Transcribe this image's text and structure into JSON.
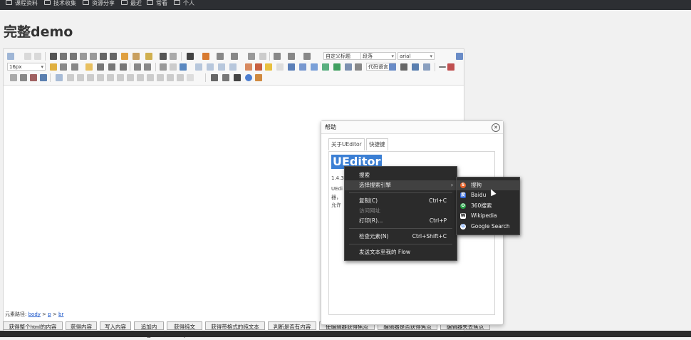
{
  "bookmarks": [
    "课程资料",
    "技术收集",
    "资源分享",
    "最近",
    "常看",
    "个人"
  ],
  "page_title": "完整demo",
  "toolbar": {
    "font_size": "16px",
    "custom_title": "自定义标题",
    "paragraph": "段落",
    "font_family": "arial",
    "code_lang": "代码语言"
  },
  "element_path": {
    "label": "元素路径:",
    "body": "body",
    "p": "p",
    "br": "br",
    "sep": ">"
  },
  "buttons": [
    "获得整个html的内容",
    "获得内容",
    "写入内容",
    "追加内容",
    "获得纯文本",
    "获得带格式的纯文本",
    "判断是否有内容",
    "使编辑器获得焦点",
    "编辑器是否获得焦点",
    "编辑器失去焦点"
  ],
  "dialog": {
    "title": "帮助",
    "close": "✕",
    "tabs": [
      "关于UEditor",
      "快捷键"
    ],
    "logo": "UEditor",
    "version": "1.4.3",
    "lines": [
      "UEdi",
      "器，",
      "允许"
    ]
  },
  "context_menu": {
    "items": [
      {
        "label": "搜索",
        "shortcut": ""
      },
      {
        "label": "选择搜索引擎",
        "shortcut": "",
        "arrow": "›"
      },
      {
        "label": "复制(C)",
        "shortcut": "Ctrl+C"
      },
      {
        "label": "访问网址",
        "shortcut": ""
      },
      {
        "label": "打印(R)...",
        "shortcut": "Ctrl+P"
      },
      {
        "label": "检查元素(N)",
        "shortcut": "Ctrl+Shift+C"
      },
      {
        "label": "发送文本至我的 Flow",
        "shortcut": ""
      }
    ]
  },
  "submenu": {
    "items": [
      {
        "label": "搜狗",
        "icon": "sogou-icon",
        "color": "#e8642c",
        "glyph": "S"
      },
      {
        "label": "Baidu",
        "icon": "baidu-icon",
        "color": "#3266d6",
        "glyph": "度"
      },
      {
        "label": "360搜索",
        "icon": "360-icon",
        "color": "#2aa44a",
        "glyph": "O"
      },
      {
        "label": "Wikipedia",
        "icon": "wikipedia-icon",
        "color": "#ffffff",
        "glyph": "W"
      },
      {
        "label": "Google Search",
        "icon": "google-icon",
        "color": "#ffffff",
        "glyph": "G"
      }
    ]
  },
  "colors": {
    "accent": "#3b7fd4",
    "menu_bg": "#2b2b2b",
    "topbar": "#2d2f33"
  }
}
